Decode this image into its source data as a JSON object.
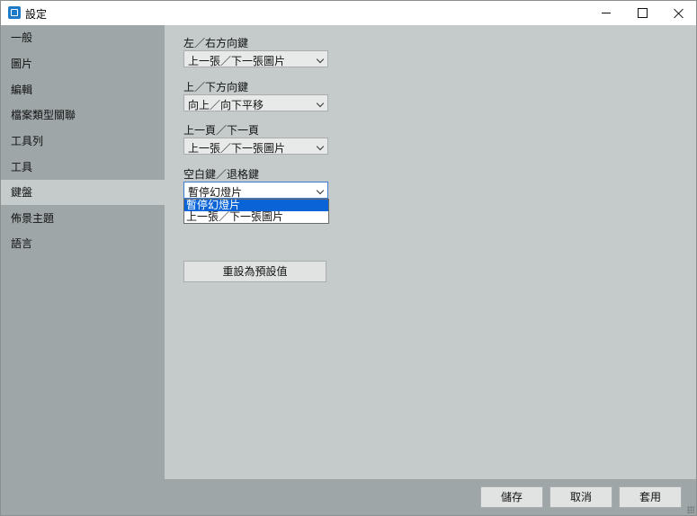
{
  "window": {
    "title": "設定",
    "controls": {
      "minimize": "minimize-icon",
      "maximize": "maximize-icon",
      "close": "close-icon"
    }
  },
  "sidebar": {
    "items": [
      {
        "label": "一般"
      },
      {
        "label": "圖片"
      },
      {
        "label": "編輯"
      },
      {
        "label": "檔案類型關聯"
      },
      {
        "label": "工具列"
      },
      {
        "label": "工具"
      },
      {
        "label": "鍵盤"
      },
      {
        "label": "佈景主題"
      },
      {
        "label": "語言"
      }
    ],
    "active": "鍵盤"
  },
  "main": {
    "groups": [
      {
        "label": "左／右方向鍵",
        "value": "上一張／下一張圖片"
      },
      {
        "label": "上／下方向鍵",
        "value": "向上／向下平移"
      },
      {
        "label": "上一頁／下一頁",
        "value": "上一張／下一張圖片"
      },
      {
        "label": "空白鍵／退格鍵",
        "value": "暫停幻燈片"
      }
    ],
    "dropdown_options": [
      "暫停幻燈片",
      "上一張／下一張圖片"
    ],
    "dropdown_selected": "暫停幻燈片",
    "reset_label": "重設為預設值"
  },
  "footer": {
    "save_label": "儲存",
    "cancel_label": "取消",
    "apply_label": "套用"
  },
  "colors": {
    "selection": "#0a64d8",
    "sidebar_bg": "#9ea6a8",
    "panel_bg": "#c5cbcb"
  }
}
